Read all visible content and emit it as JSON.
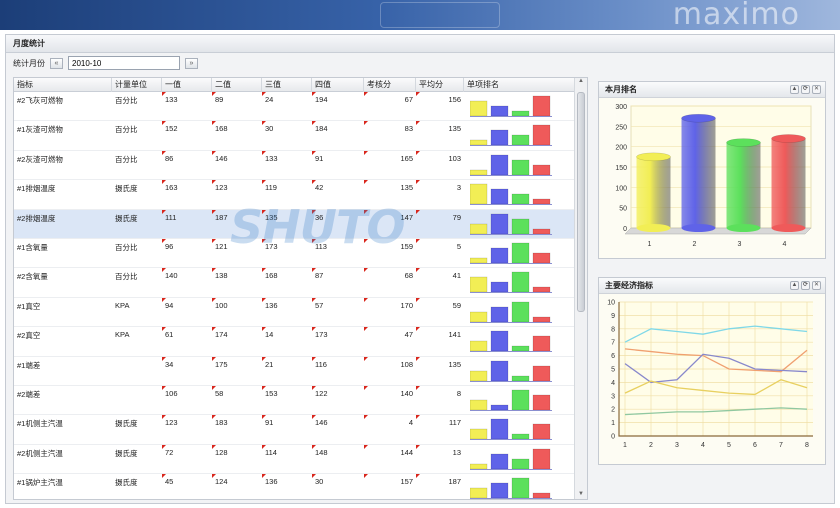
{
  "banner": {
    "brand": "maximo"
  },
  "panel": {
    "title": "月度统计"
  },
  "filter": {
    "label": "统计月份",
    "prev": "«",
    "next": "»",
    "month": "2010-10"
  },
  "grid": {
    "columns": [
      "指标",
      "计量单位",
      "一值",
      "二值",
      "三值",
      "四值",
      "考核分",
      "平均分",
      "单项排名"
    ],
    "rows": [
      {
        "name": "#2飞灰可燃物",
        "unit": "百分比",
        "v1": "133",
        "v2": "89",
        "v3": "24",
        "v4": "194",
        "score": "67",
        "avg": "156",
        "rank": [
          3,
          2,
          1,
          4
        ]
      },
      {
        "name": "#1灰渣可燃物",
        "unit": "百分比",
        "v1": "152",
        "v2": "168",
        "v3": "30",
        "v4": "184",
        "score": "83",
        "avg": "135",
        "rank": [
          1,
          3,
          2,
          4
        ]
      },
      {
        "name": "#2灰渣可燃物",
        "unit": "百分比",
        "v1": "86",
        "v2": "146",
        "v3": "133",
        "v4": "91",
        "score": "165",
        "avg": "103",
        "rank": [
          1,
          4,
          3,
          2
        ]
      },
      {
        "name": "#1排烟温度",
        "unit": "摄氏度",
        "v1": "163",
        "v2": "123",
        "v3": "119",
        "v4": "42",
        "score": "135",
        "avg": "3",
        "rank": [
          4,
          3,
          2,
          1
        ]
      },
      {
        "name": "#2排烟温度",
        "unit": "摄氏度",
        "v1": "111",
        "v2": "187",
        "v3": "135",
        "v4": "36",
        "score": "147",
        "avg": "79",
        "rank": [
          2,
          4,
          3,
          1
        ]
      },
      {
        "name": "#1含氧量",
        "unit": "百分比",
        "v1": "96",
        "v2": "121",
        "v3": "173",
        "v4": "113",
        "score": "159",
        "avg": "5",
        "rank": [
          1,
          3,
          4,
          2
        ]
      },
      {
        "name": "#2含氧量",
        "unit": "百分比",
        "v1": "140",
        "v2": "138",
        "v3": "168",
        "v4": "87",
        "score": "68",
        "avg": "41",
        "rank": [
          3,
          2,
          4,
          1
        ]
      },
      {
        "name": "#1真空",
        "unit": "KPA",
        "v1": "94",
        "v2": "100",
        "v3": "136",
        "v4": "57",
        "score": "170",
        "avg": "59",
        "rank": [
          2,
          3,
          4,
          1
        ]
      },
      {
        "name": "#2真空",
        "unit": "KPA",
        "v1": "61",
        "v2": "174",
        "v3": "14",
        "v4": "173",
        "score": "47",
        "avg": "141",
        "rank": [
          2,
          4,
          1,
          3
        ]
      },
      {
        "name": "#1端差",
        "unit": "",
        "v1": "34",
        "v2": "175",
        "v3": "21",
        "v4": "116",
        "score": "108",
        "avg": "135",
        "rank": [
          2,
          4,
          1,
          3
        ]
      },
      {
        "name": "#2端差",
        "unit": "",
        "v1": "106",
        "v2": "58",
        "v3": "153",
        "v4": "122",
        "score": "140",
        "avg": "8",
        "rank": [
          2,
          1,
          4,
          3
        ]
      },
      {
        "name": "#1机侧主汽温",
        "unit": "摄氏度",
        "v1": "123",
        "v2": "183",
        "v3": "91",
        "v4": "146",
        "score": "4",
        "avg": "117",
        "rank": [
          2,
          4,
          1,
          3
        ]
      },
      {
        "name": "#2机侧主汽温",
        "unit": "摄氏度",
        "v1": "72",
        "v2": "128",
        "v3": "114",
        "v4": "148",
        "score": "144",
        "avg": "13",
        "rank": [
          1,
          3,
          2,
          4
        ]
      },
      {
        "name": "#1锅炉主汽温",
        "unit": "摄氏度",
        "v1": "45",
        "v2": "124",
        "v3": "136",
        "v4": "30",
        "score": "157",
        "avg": "187",
        "rank": [
          2,
          3,
          4,
          1
        ]
      }
    ]
  },
  "widgets": {
    "ranking": {
      "title": "本月排名"
    },
    "econ": {
      "title": "主要经济指标"
    },
    "tools": [
      "▲",
      "⟳",
      "✕"
    ]
  },
  "chart_data": [
    {
      "type": "bar",
      "categories": [
        "1",
        "2",
        "3",
        "4"
      ],
      "values": [
        175,
        270,
        210,
        220
      ],
      "ylim": [
        0,
        300
      ],
      "yticks": [
        "0",
        "50",
        "100",
        "150",
        "200",
        "250",
        "300"
      ],
      "grid": true,
      "colors": [
        "#f2ee55",
        "#5f63e8",
        "#5ce05c",
        "#ef5a5a"
      ]
    },
    {
      "type": "line",
      "x": [
        "1",
        "2",
        "3",
        "4",
        "5",
        "6",
        "7",
        "8"
      ],
      "ylim": [
        0,
        10
      ],
      "yticks": [
        "0",
        "1",
        "2",
        "3",
        "4",
        "5",
        "6",
        "7",
        "8",
        "9",
        "10"
      ],
      "grid": true,
      "series": [
        {
          "color": "#7fd8e8",
          "values": [
            7.0,
            8.0,
            7.8,
            7.6,
            8.0,
            8.2,
            8.0,
            7.8
          ]
        },
        {
          "color": "#f0a070",
          "values": [
            6.5,
            6.3,
            6.1,
            6.0,
            5.0,
            4.9,
            4.8,
            6.4
          ]
        },
        {
          "color": "#8888cc",
          "values": [
            5.4,
            4.0,
            4.2,
            6.1,
            5.8,
            5.0,
            4.9,
            4.8
          ]
        },
        {
          "color": "#e8d060",
          "values": [
            3.2,
            4.1,
            3.6,
            3.4,
            3.2,
            3.1,
            4.2,
            3.6
          ]
        },
        {
          "color": "#90c8a0",
          "values": [
            1.6,
            1.7,
            1.8,
            1.8,
            1.9,
            2.0,
            2.1,
            2.0
          ]
        }
      ]
    }
  ]
}
